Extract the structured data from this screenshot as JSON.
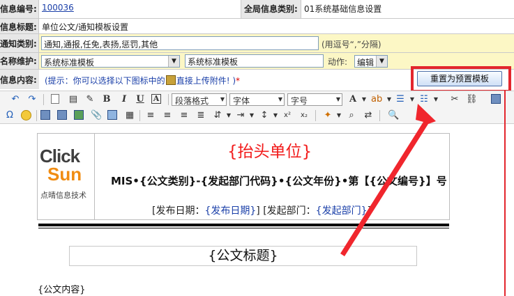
{
  "row1": {
    "label_a": "信息编号:",
    "value_a": "100036",
    "label_b": "全局信息类别:",
    "value_b": "01系统基础信息设置"
  },
  "row2": {
    "label": "信息标题:",
    "value": "单位公文/通知模板设置"
  },
  "row3": {
    "label": "通知类别:",
    "value": "通知,通报,任免,表扬,惩罚,其他",
    "hint": "(用逗号“,”分隔)"
  },
  "row4": {
    "label": "名称维护:",
    "select_value": "系统标准模板",
    "input_value": "系统标准模板",
    "action_label": "动作:",
    "action_value": "编辑"
  },
  "row5": {
    "label": "信息内容:",
    "tip_before": "(提示：你可以选择以下图标中的",
    "tip_after": "直接上传附件! )",
    "required_mark": "*",
    "reset_button": "重置为预置模板"
  },
  "toolbar": {
    "paragraph_format": "段落格式",
    "font": "字体",
    "font_size": "字号",
    "font_color_glyph": "A"
  },
  "document": {
    "logo_click": "Click",
    "logo_sun": "Sun",
    "logo_subtitle": "点晴信息技术",
    "header_title": "{抬头单位}",
    "ref_line": "MIS•{公文类别}-{发起部门代码}•{公文年份}•第【{公文编号}】号",
    "publish_label": "[发布日期：",
    "publish_value": "{发布日期}",
    "dept_label": "] [发起部门：",
    "dept_value": "{发起部门}",
    "closing": "]",
    "title_placeholder": "{公文标题}",
    "content_placeholder": "{公文内容}"
  },
  "colors": {
    "highlight_border": "#e3262d",
    "editable_row_bg": "#fcf7c5",
    "link_blue": "#1a3fa8",
    "header_red": "#f21c1c"
  }
}
